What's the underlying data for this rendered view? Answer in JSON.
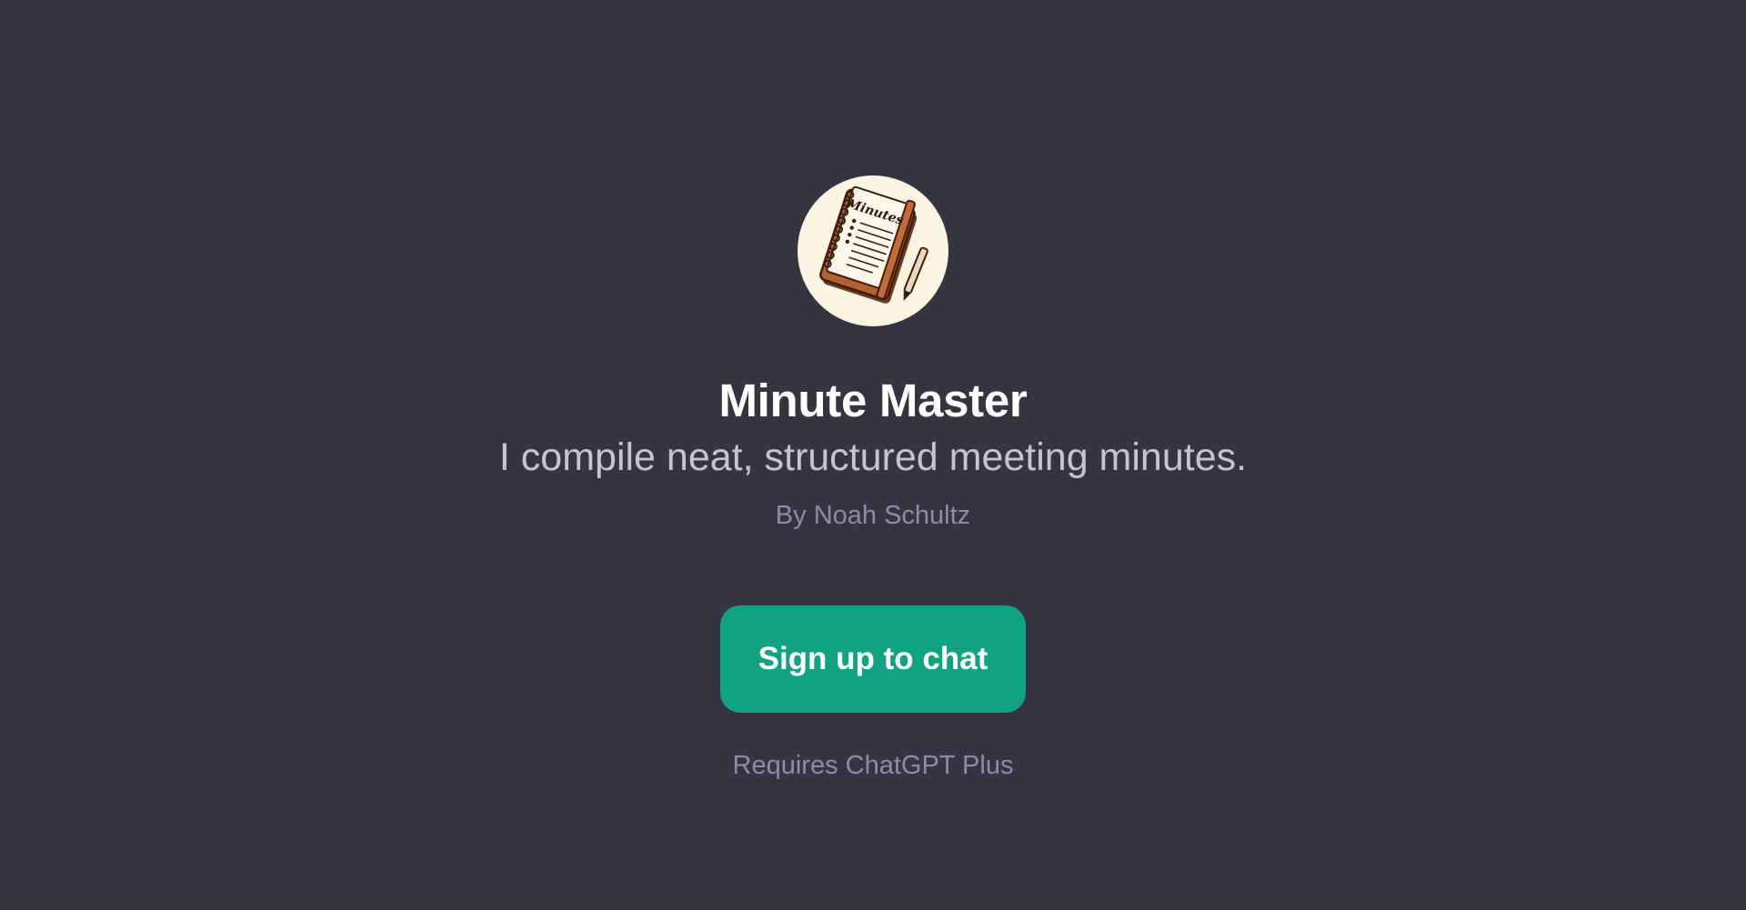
{
  "gpt": {
    "name": "Minute Master",
    "description": "I compile neat, structured meeting minutes.",
    "author": "By Noah Schultz",
    "avatar_icon": "notebook-icon",
    "avatar_label": "Minutes"
  },
  "cta": {
    "label": "Sign up to chat"
  },
  "requirement": "Requires ChatGPT Plus",
  "colors": {
    "background": "#343541",
    "accent": "#10a37f",
    "avatar_bg": "#fbf4e2"
  }
}
